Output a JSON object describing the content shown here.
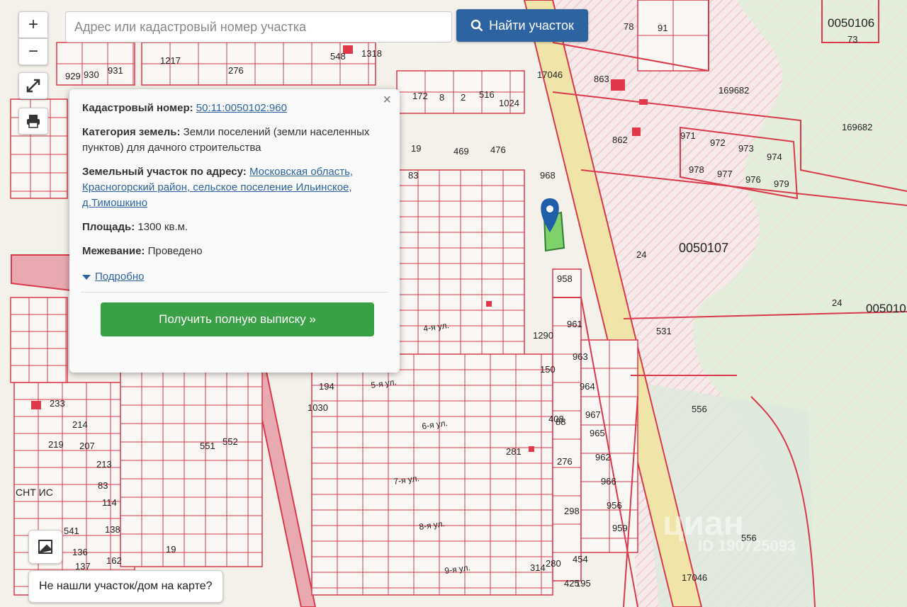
{
  "search": {
    "placeholder": "Адрес или кадастровый номер участка",
    "button_label": "Найти участок"
  },
  "controls": {
    "zoom_in": "+",
    "zoom_out": "−"
  },
  "popup": {
    "cadastral_label": "Кадастровый номер:",
    "cadastral_value": "50:11:0050102:960",
    "category_label": "Категория земель:",
    "category_value": "Земли поселений (земли населенных пунктов) для дачного строительства",
    "address_label": "Земельный участок по адресу:",
    "address_value": "Московская область, Красногорский район, сельское поселение Ильинское, д.Тимошкино",
    "area_label": "Площадь:",
    "area_value": "1300 кв.м.",
    "survey_label": "Межевание:",
    "survey_value": "Проведено",
    "more_link": "Подробно",
    "extract_button": "Получить полную выписку »",
    "close": "×"
  },
  "not_found_button": "Не нашли участок/дом на карте?",
  "map_labels": {
    "quarter_107": "0050107",
    "quarter_106": "0050106",
    "quarter_10x": "005010",
    "snt": "СНТ ИС",
    "streets": [
      "4-я ул.",
      "5-я ул.",
      "6-я ул.",
      "7-я ул.",
      "8-я ул.",
      "9-я ул."
    ],
    "parcels": [
      "78",
      "91",
      "73",
      "863",
      "169682",
      "169682",
      "862",
      "971",
      "972",
      "973",
      "974",
      "978",
      "977",
      "976",
      "979",
      "24",
      "24",
      "531",
      "556",
      "556",
      "963",
      "964",
      "967",
      "965",
      "962",
      "966",
      "956",
      "959",
      "961",
      "958",
      "968",
      "476",
      "469",
      "172",
      "8",
      "2",
      "516",
      "1024",
      "17046",
      "17046",
      "1217",
      "276",
      "931",
      "930",
      "929",
      "1318",
      "548",
      "83",
      "19",
      "281",
      "233",
      "214",
      "219",
      "207",
      "213",
      "541",
      "136",
      "137",
      "162",
      "138",
      "114",
      "83",
      "551",
      "552",
      "1030",
      "19",
      "194",
      "1290",
      "150",
      "408",
      "88",
      "276",
      "298",
      "454",
      "195",
      "314",
      "280",
      "425"
    ],
    "watermark": "циан",
    "watermark_id": "ID 190725093"
  },
  "colors": {
    "parcel_line": "#d9394a",
    "road": "#f0e3a6",
    "forest": "#dff0dc",
    "accent": "#2d63a0",
    "green_button": "#3aa046",
    "marker": "#1f5fa8"
  }
}
